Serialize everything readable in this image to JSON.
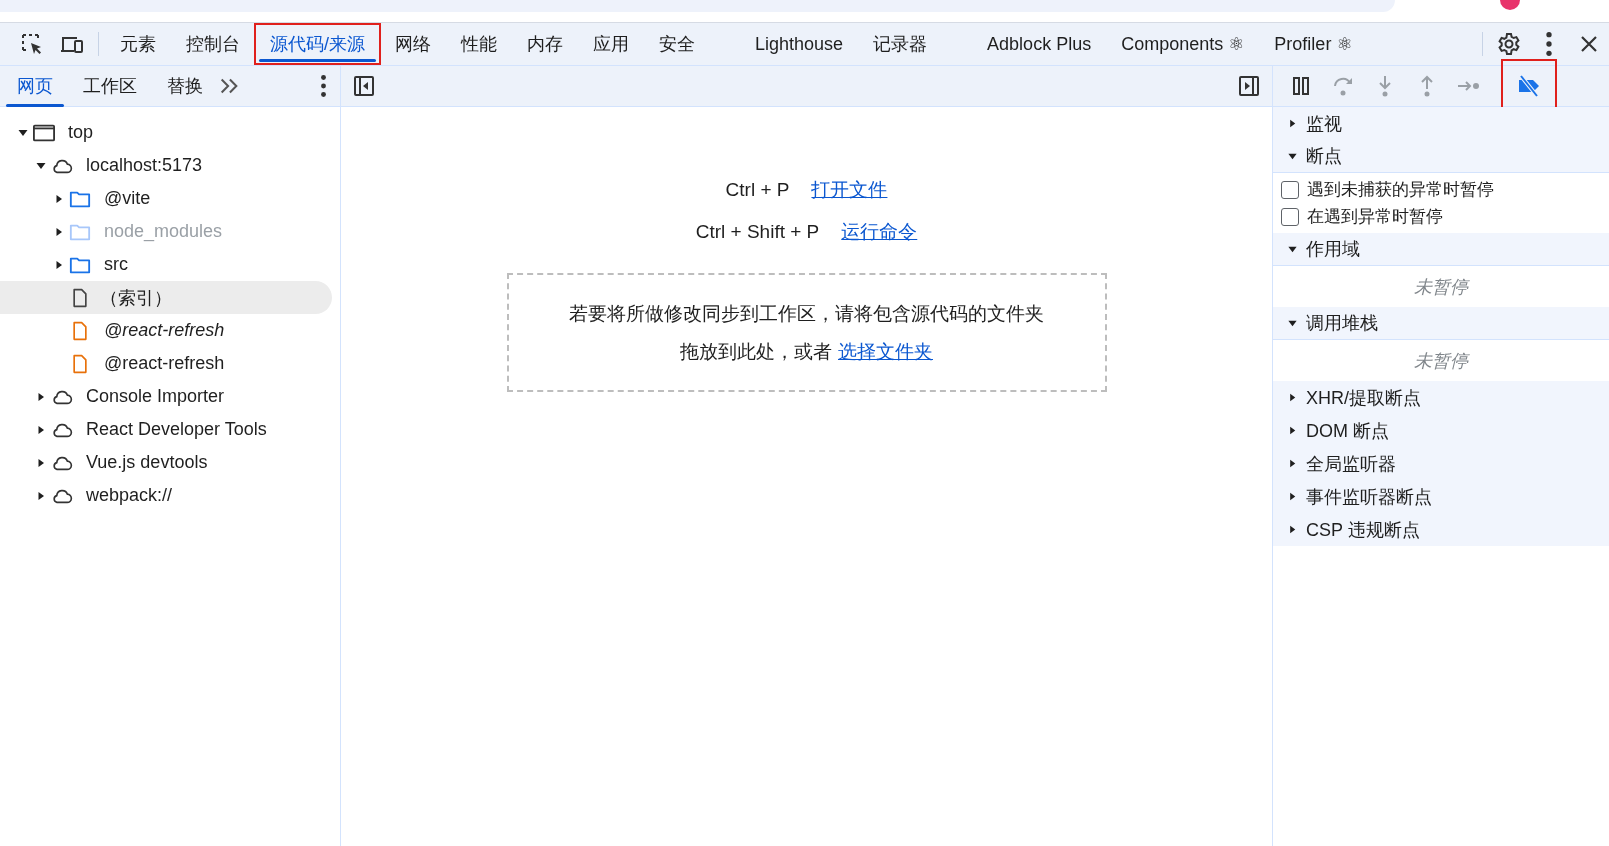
{
  "main_tabs": [
    {
      "label": "元素",
      "selected": false,
      "highlighted": false
    },
    {
      "label": "控制台",
      "selected": false,
      "highlighted": false
    },
    {
      "label": "源代码/来源",
      "selected": true,
      "highlighted": true
    },
    {
      "label": "网络",
      "selected": false,
      "highlighted": false
    },
    {
      "label": "性能",
      "selected": false,
      "highlighted": false
    },
    {
      "label": "内存",
      "selected": false,
      "highlighted": false
    },
    {
      "label": "应用",
      "selected": false,
      "highlighted": false
    },
    {
      "label": "安全",
      "selected": false,
      "highlighted": false
    },
    {
      "label": "Lighthouse",
      "selected": false,
      "highlighted": false
    },
    {
      "label": "记录器",
      "selected": false,
      "highlighted": false
    },
    {
      "label": "Adblock Plus",
      "selected": false,
      "highlighted": false
    },
    {
      "label": "Components ⚛",
      "selected": false,
      "highlighted": false
    },
    {
      "label": "Profiler ⚛",
      "selected": false,
      "highlighted": false
    }
  ],
  "navigator_tabs": [
    {
      "label": "网页",
      "selected": true
    },
    {
      "label": "工作区",
      "selected": false
    },
    {
      "label": "替换",
      "selected": false
    }
  ],
  "tree": [
    {
      "label": "top",
      "kind": "frame",
      "expanded": true,
      "children": [
        {
          "label": "localhost:5173",
          "kind": "cloud",
          "expanded": true,
          "children": [
            {
              "label": "@vite",
              "kind": "folder",
              "expanded": false,
              "dimmed": false
            },
            {
              "label": "node_modules",
              "kind": "folder",
              "expanded": false,
              "dimmed": true
            },
            {
              "label": "src",
              "kind": "folder",
              "expanded": false,
              "dimmed": false
            },
            {
              "label": "（索引）",
              "kind": "document",
              "selected": true,
              "italic": false
            },
            {
              "label": "@react-refresh",
              "kind": "script",
              "selected": false,
              "italic": true
            },
            {
              "label": "@react-refresh",
              "kind": "script",
              "selected": false,
              "italic": false
            }
          ]
        },
        {
          "label": "Console Importer",
          "kind": "cloud",
          "expanded": false
        },
        {
          "label": "React Developer Tools",
          "kind": "cloud",
          "expanded": false
        },
        {
          "label": "Vue.js devtools",
          "kind": "cloud",
          "expanded": false
        },
        {
          "label": "webpack://",
          "kind": "cloud",
          "expanded": false
        }
      ]
    }
  ],
  "editor": {
    "shortcuts": [
      {
        "keys": "Ctrl + P",
        "action": "打开文件"
      },
      {
        "keys": "Ctrl + Shift + P",
        "action": "运行命令"
      }
    ],
    "drop_hint": "若要将所做修改同步到工作区，请将包含源代码的文件夹",
    "drop_hint_2": "拖放到此处，或者",
    "drop_link": "选择文件夹"
  },
  "debugger_toolbar": [
    {
      "kind": "pause",
      "disabled": false,
      "active": false,
      "highlighted": false
    },
    {
      "kind": "step-over",
      "disabled": true,
      "active": false,
      "highlighted": false
    },
    {
      "kind": "step-into",
      "disabled": true,
      "active": false,
      "highlighted": false
    },
    {
      "kind": "step-out",
      "disabled": true,
      "active": false,
      "highlighted": false
    },
    {
      "kind": "step",
      "disabled": true,
      "active": false,
      "highlighted": false
    },
    {
      "kind": "deactivate-breakpoints",
      "disabled": false,
      "active": true,
      "highlighted": true
    }
  ],
  "sections": [
    {
      "title": "监视",
      "expanded": false
    },
    {
      "title": "断点",
      "expanded": true,
      "checkboxes": [
        {
          "label": "遇到未捕获的异常时暂停",
          "checked": false
        },
        {
          "label": "在遇到异常时暂停",
          "checked": false
        }
      ]
    },
    {
      "title": "作用域",
      "expanded": true,
      "placeholder": "未暂停"
    },
    {
      "title": "调用堆栈",
      "expanded": true,
      "placeholder": "未暂停"
    },
    {
      "title": "XHR/提取断点",
      "expanded": false
    },
    {
      "title": "DOM 断点",
      "expanded": false
    },
    {
      "title": "全局监听器",
      "expanded": false
    },
    {
      "title": "事件监听器断点",
      "expanded": false
    },
    {
      "title": "CSP 违规断点",
      "expanded": false
    }
  ]
}
